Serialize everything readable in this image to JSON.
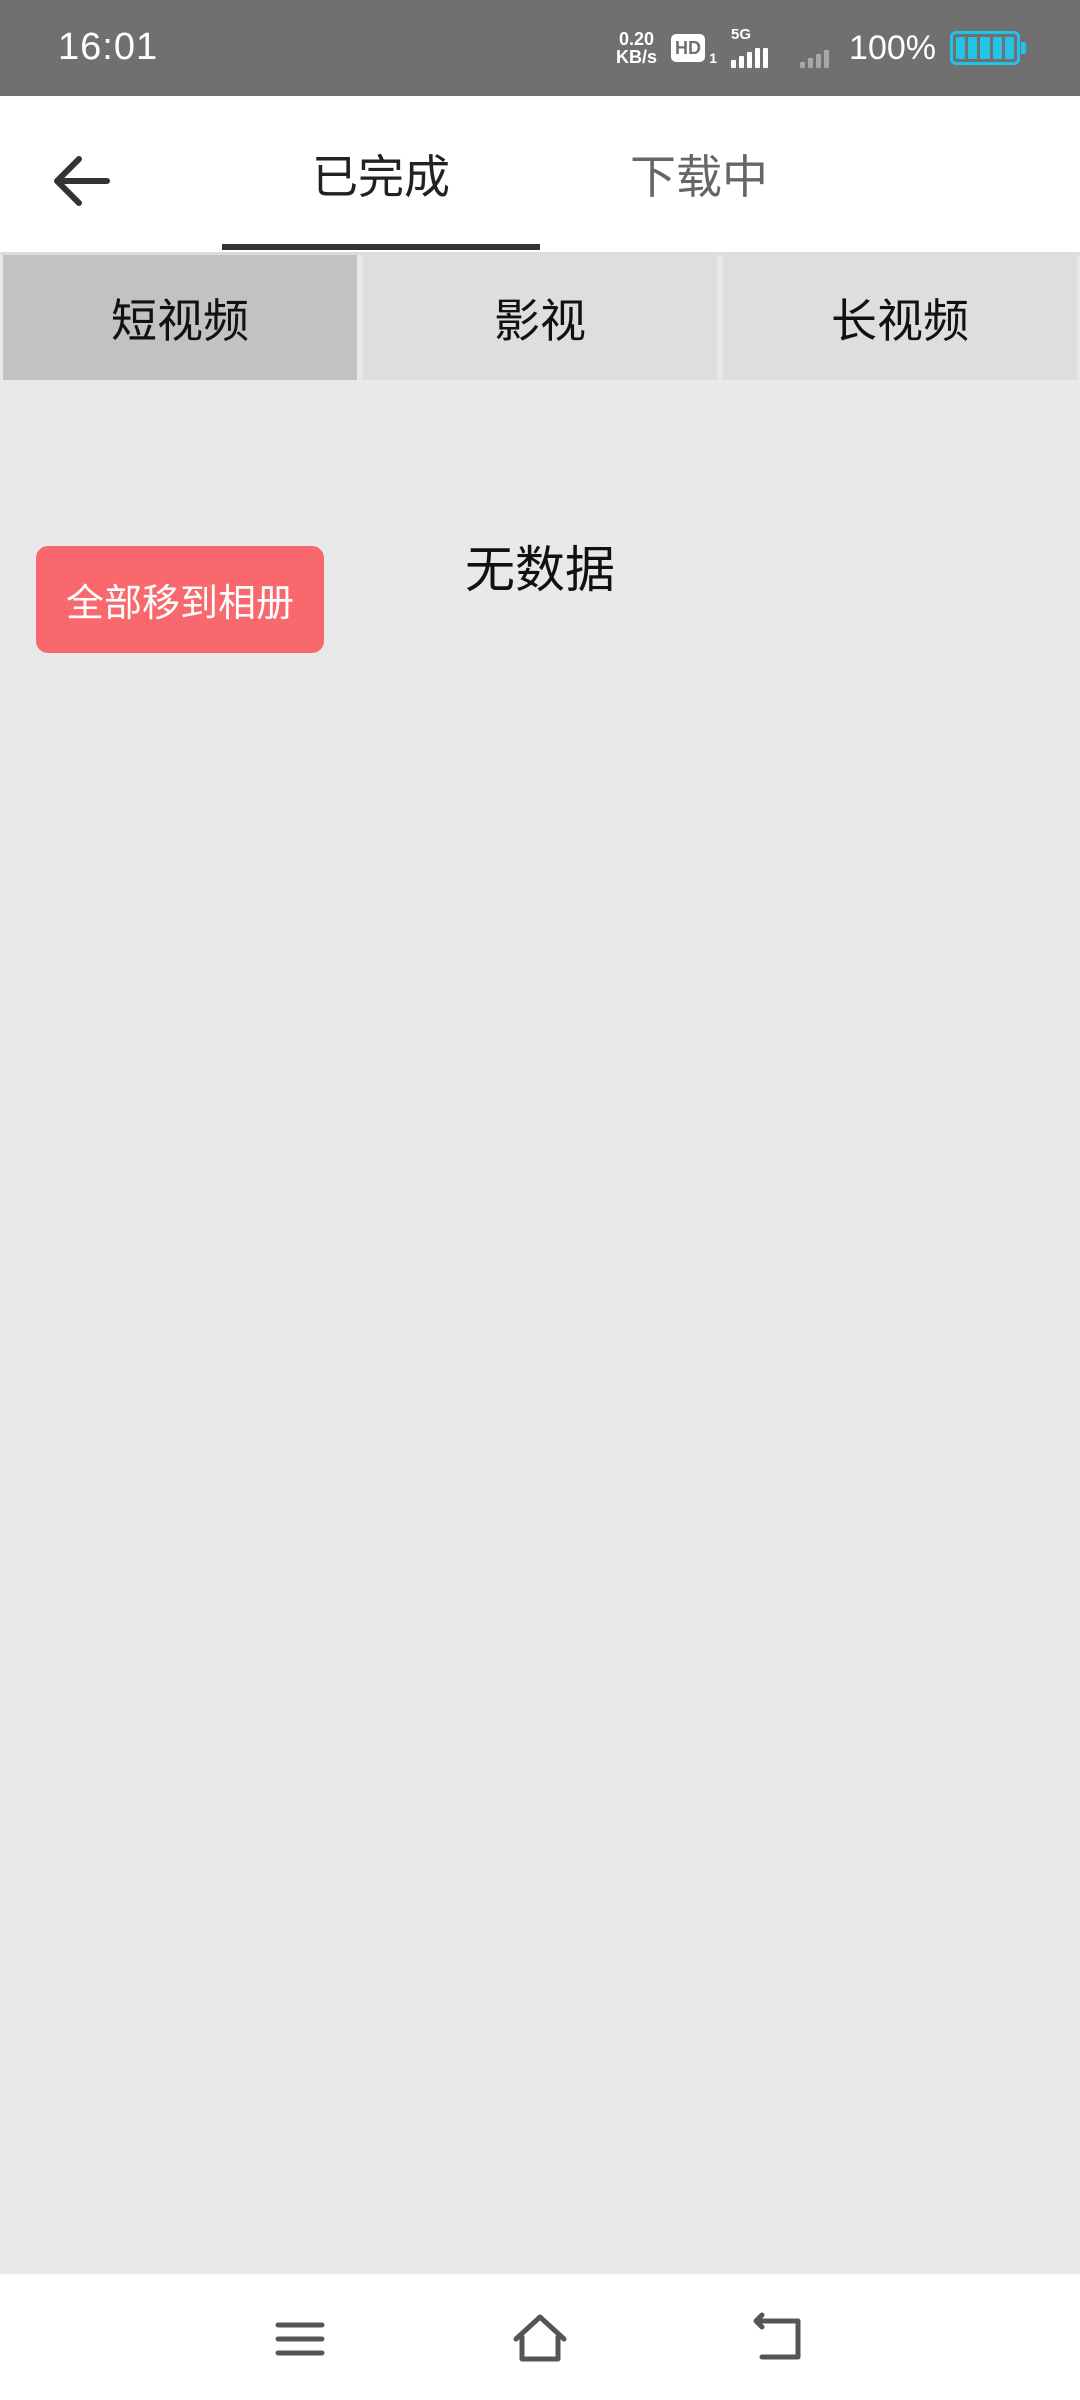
{
  "status_bar": {
    "time": "16:01",
    "net_speed_value": "0.20",
    "net_speed_unit": "KB/s",
    "hd_label": "HD",
    "hd_sub": "1",
    "network_type": "5G",
    "battery_percent": "100%",
    "battery_level": 1.0,
    "battery_color": "#22c3e6"
  },
  "header": {
    "tabs": [
      {
        "label": "已完成",
        "active": true
      },
      {
        "label": "下载中",
        "active": false
      }
    ]
  },
  "category_tabs": [
    {
      "label": "短视频",
      "selected": true
    },
    {
      "label": "影视",
      "selected": false
    },
    {
      "label": "长视频",
      "selected": false
    }
  ],
  "content": {
    "empty_message": "无数据",
    "move_all_label": "全部移到相册",
    "move_all_color": "#f8686c"
  },
  "nav_bar": {
    "icons": [
      "menu-icon",
      "home-icon",
      "back-icon"
    ]
  }
}
